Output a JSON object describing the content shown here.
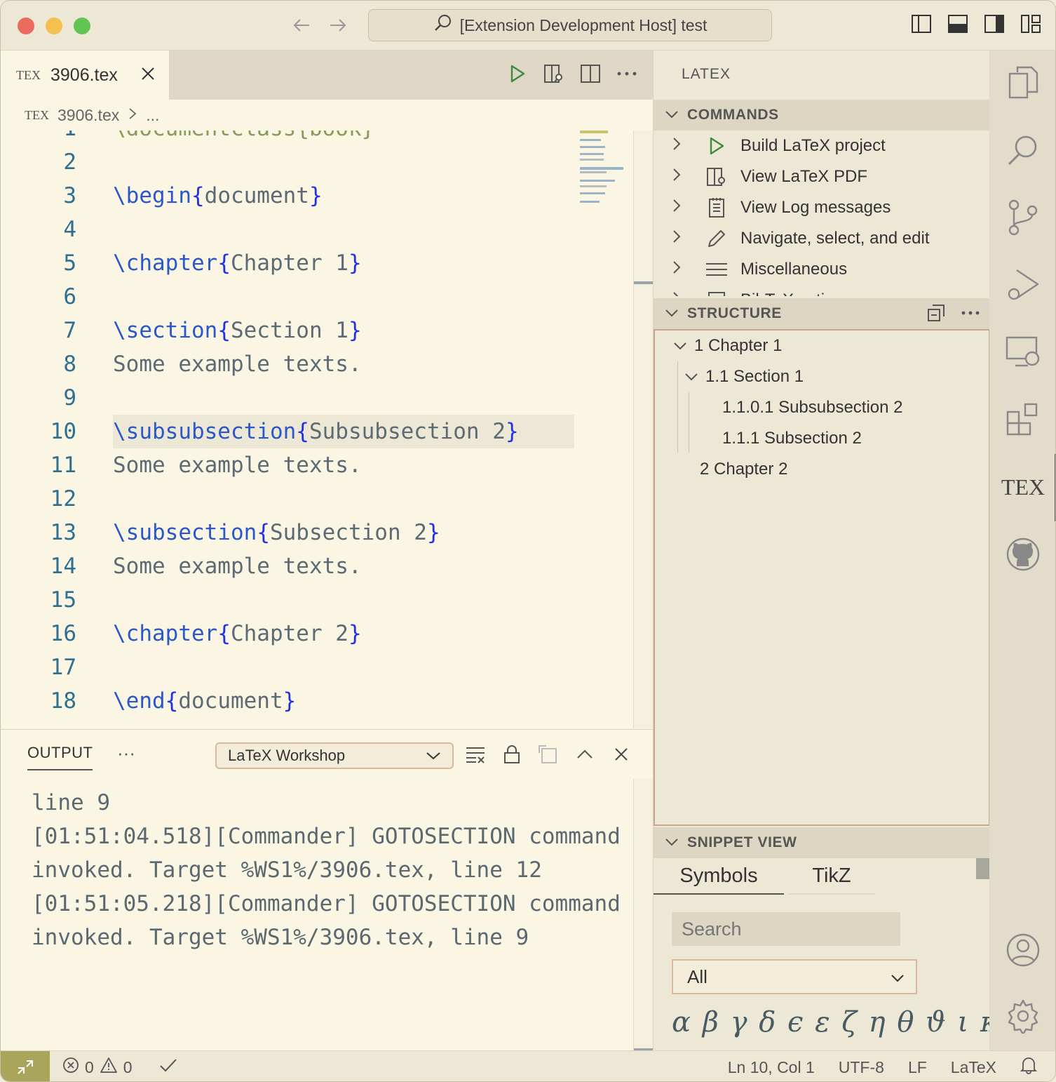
{
  "window": {
    "title": "[Extension Development Host] test"
  },
  "tab": {
    "filename": "3906.tex",
    "icon": "tex-logo",
    "logo_text": "TEX"
  },
  "breadcrumb": {
    "file": "3906.tex",
    "rest": "..."
  },
  "editor": {
    "lines": [
      {
        "n": "1",
        "code": "\\documentclass{book}"
      },
      {
        "n": "2",
        "code": ""
      },
      {
        "n": "3",
        "cmd": "\\begin",
        "open": "{",
        "arg": "document",
        "close": "}"
      },
      {
        "n": "4",
        "code": ""
      },
      {
        "n": "5",
        "cmd": "\\chapter",
        "open": "{",
        "arg": "Chapter 1",
        "close": "}"
      },
      {
        "n": "6",
        "code": ""
      },
      {
        "n": "7",
        "cmd": "\\section",
        "open": "{",
        "arg": "Section 1",
        "close": "}"
      },
      {
        "n": "8",
        "code": "Some example texts."
      },
      {
        "n": "9",
        "code": ""
      },
      {
        "n": "10",
        "cmd": "\\subsubsection",
        "open": "{",
        "arg": "Subsubsection 2",
        "close": "}",
        "highlight": true
      },
      {
        "n": "11",
        "code": "Some example texts."
      },
      {
        "n": "12",
        "code": ""
      },
      {
        "n": "13",
        "cmd": "\\subsection",
        "open": "{",
        "arg": "Subsection 2",
        "close": "}"
      },
      {
        "n": "14",
        "code": "Some example texts."
      },
      {
        "n": "15",
        "code": ""
      },
      {
        "n": "16",
        "cmd": "\\chapter",
        "open": "{",
        "arg": "Chapter 2",
        "close": "}"
      },
      {
        "n": "17",
        "code": ""
      },
      {
        "n": "18",
        "cmd": "\\end",
        "open": "{",
        "arg": "document",
        "close": "}"
      }
    ]
  },
  "panel": {
    "tab_label": "OUTPUT",
    "more": "···",
    "channel": "LaTeX Workshop",
    "output_text": "line 9\n[01:51:04.518][Commander] GOTOSECTION command invoked. Target %WS1%/3906.tex, line 12\n[01:51:05.218][Commander] GOTOSECTION command invoked. Target %WS1%/3906.tex, line 9"
  },
  "sidebar": {
    "title": "LATEX",
    "commands_header": "COMMANDS",
    "commands": [
      {
        "label": "Build LaTeX project",
        "icon": "play-icon"
      },
      {
        "label": "View LaTeX PDF",
        "icon": "view-pdf-icon"
      },
      {
        "label": "View Log messages",
        "icon": "log-icon"
      },
      {
        "label": "Navigate, select, and edit",
        "icon": "pencil-icon"
      },
      {
        "label": "Miscellaneous",
        "icon": "menu-icon"
      },
      {
        "label": "BibTeX actions",
        "icon": "bibtex-icon"
      }
    ],
    "structure_header": "STRUCTURE",
    "structure": {
      "ch1": "1 Chapter 1",
      "sec1": "1.1 Section 1",
      "subsub": "1.1.0.1 Subsubsection 2",
      "sub": "1.1.1 Subsection 2",
      "ch2": "2 Chapter 2"
    },
    "snippet_header": "SNIPPET VIEW",
    "snippet_tabs": [
      "Symbols",
      "TikZ"
    ],
    "search_placeholder": "Search",
    "filter_value": "All",
    "symbols": "α β γ δ ϵ ε ζ η θ ϑ ι κ λ"
  },
  "activity": {
    "tex_label": "TEX"
  },
  "status": {
    "errors": "0",
    "warnings": "0",
    "position": "Ln 10, Col 1",
    "encoding": "UTF-8",
    "eol": "LF",
    "language": "LaTeX"
  }
}
